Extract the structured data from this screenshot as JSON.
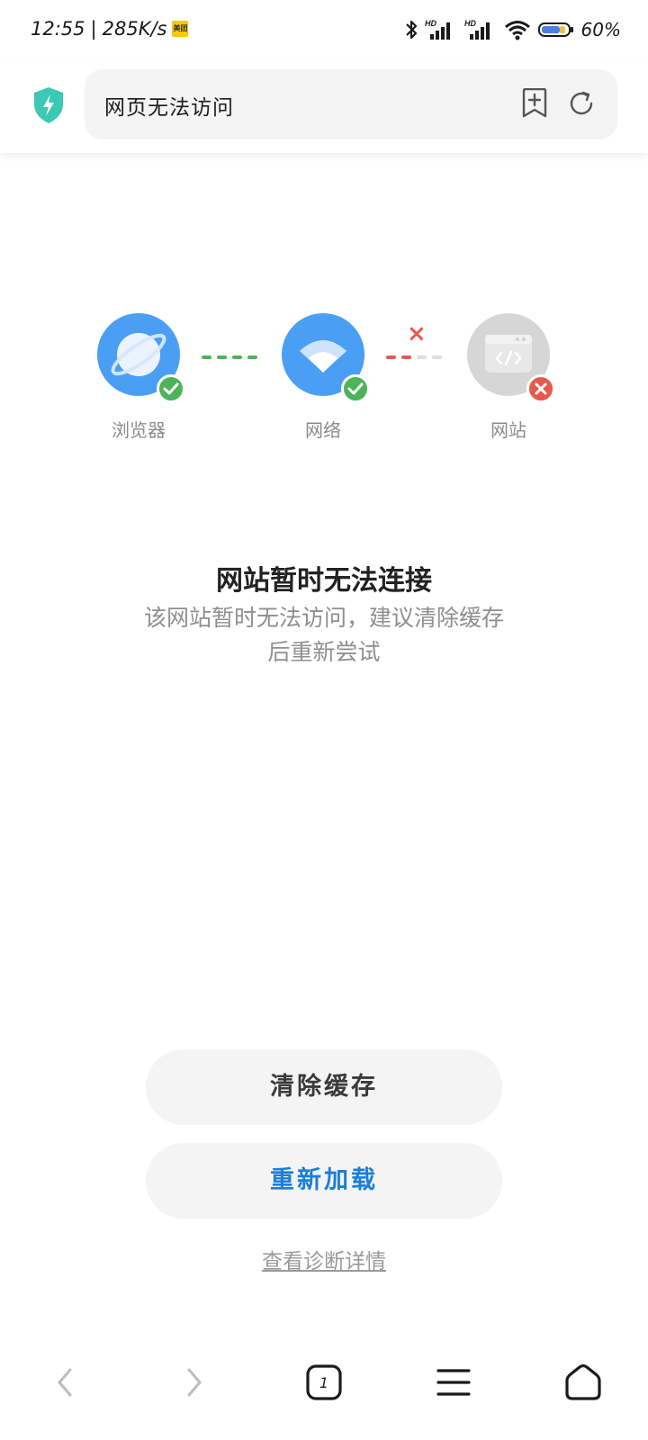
{
  "status_bar": {
    "time": "12:55",
    "separator": "|",
    "speed": "285K/s",
    "app_badge": "美团",
    "hd1": "HD",
    "hd2": "HD",
    "battery": "60%"
  },
  "address_bar": {
    "title": "网页无法访问",
    "shield_color": "#3cc8b4"
  },
  "diagram": {
    "nodes": [
      {
        "label": "浏览器",
        "color": "#4a9ff5",
        "status": "ok"
      },
      {
        "label": "网络",
        "color": "#4a9ff5",
        "status": "ok"
      },
      {
        "label": "网站",
        "color": "#d6d6d6",
        "status": "error"
      }
    ],
    "ok_color": "#4db35a",
    "error_color": "#e8594d",
    "x_mark": "×"
  },
  "message": {
    "title": "网站暂时无法连接",
    "body": "该网站暂时无法访问，建议清除缓存后重新尝试"
  },
  "actions": {
    "clear_cache": "清除缓存",
    "reload": "重新加载",
    "diagnostics": "查看诊断详情"
  },
  "bottom_nav": {
    "tab_count": "1"
  }
}
